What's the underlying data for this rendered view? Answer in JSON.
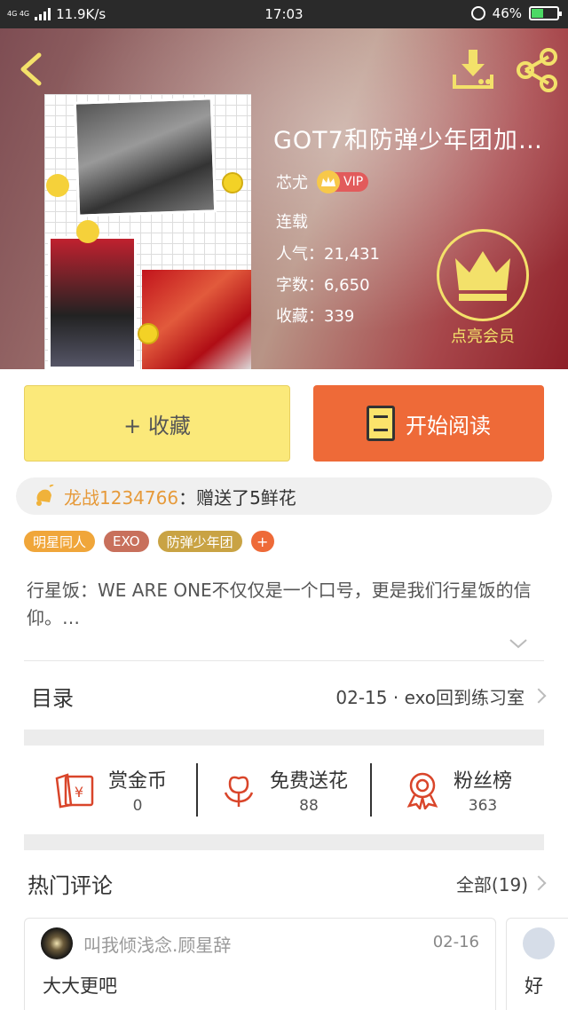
{
  "status_bar": {
    "network": "4G 4G",
    "speed": "11.9K/s",
    "time": "17:03",
    "battery": "46%",
    "battery_level": 0.46
  },
  "book": {
    "title": "GOT7和防弹少年团加…",
    "author": "芯尤",
    "vip_label": "VIP",
    "status": "连载",
    "popularity_label": "人气：",
    "popularity": "21,431",
    "words_label": "字数：",
    "words": "6,650",
    "favorites_label": "收藏：",
    "favorites": "339"
  },
  "member": {
    "label": "点亮会员"
  },
  "actions": {
    "collect_label": "+ 收藏",
    "read_label": "开始阅读"
  },
  "gift": {
    "user": "龙战1234766",
    "action": "：赠送了5鲜花"
  },
  "tags": [
    {
      "label": "明星同人",
      "color": "#f0a63a"
    },
    {
      "label": "EXO",
      "color": "#c8705c"
    },
    {
      "label": "防弹少年团",
      "color": "#c9a344"
    }
  ],
  "tag_add": "+",
  "intro": "行星饭：WE ARE ONE不仅仅是一个口号，更是我们行星饭的信仰。…",
  "toc": {
    "label": "目录",
    "latest": "02-15 · exo回到练习室"
  },
  "stats": [
    {
      "name": "赏金币",
      "value": "0",
      "icon": "coin-envelope-icon"
    },
    {
      "name": "免费送花",
      "value": "88",
      "icon": "flower-icon"
    },
    {
      "name": "粉丝榜",
      "value": "363",
      "icon": "medal-icon"
    }
  ],
  "comments": {
    "title": "热门评论",
    "all_label": "全部(19)",
    "items": [
      {
        "name": "叫我倾浅念.顾星辞",
        "date": "02-16",
        "text": "大大更吧"
      },
      {
        "name": "",
        "date": "",
        "text": "好"
      }
    ]
  },
  "colors": {
    "accent_orange": "#ee6a38",
    "collect_yellow": "#fbe97a",
    "member_gold": "#f3e16a"
  }
}
